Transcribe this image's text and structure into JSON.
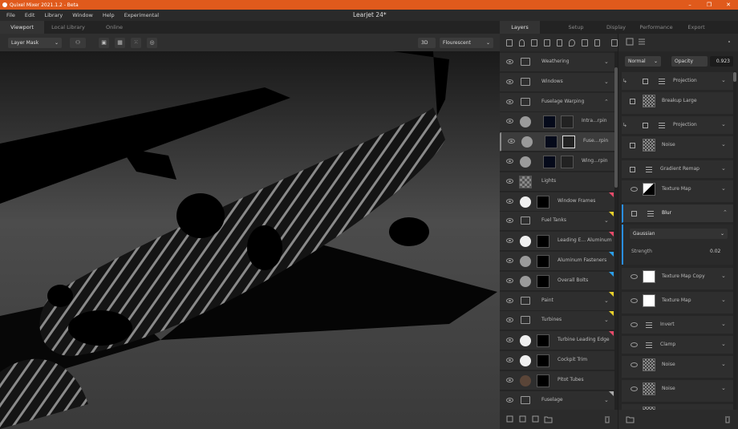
{
  "app": {
    "title": "Quixel Mixer 2021.1.2 - Beta",
    "doc_title": "Learjet 24*"
  },
  "menu": [
    "File",
    "Edit",
    "Library",
    "Window",
    "Help",
    "Experimental"
  ],
  "viewport_tabs": [
    "Viewport",
    "Local Library",
    "Online"
  ],
  "viewport_toolbar": {
    "mask_mode": "Layer Mask",
    "view_mode": "3D",
    "lighting": "Flourescent"
  },
  "right_tabs": [
    "Layers",
    "Setup",
    "Display",
    "Performance",
    "Export"
  ],
  "layers": [
    {
      "name": "Weathering",
      "kind": "folder",
      "chevron": "down",
      "flag": ""
    },
    {
      "name": "Windows",
      "kind": "folder",
      "chevron": "down",
      "flag": ""
    },
    {
      "name": "Fuselage Warping",
      "kind": "folder",
      "chevron": "up",
      "flag": ""
    },
    {
      "name": "Intra...rpin",
      "kind": "sub",
      "flag": ""
    },
    {
      "name": "Fuse...rpin",
      "kind": "sub",
      "flag": "",
      "selected": true
    },
    {
      "name": "Wing...rpin",
      "kind": "sub",
      "flag": ""
    },
    {
      "name": "Lights",
      "kind": "checker",
      "flag": ""
    },
    {
      "name": "Window Frames",
      "kind": "white",
      "flag": "#e84a6a"
    },
    {
      "name": "Fuel Tanks",
      "kind": "folder",
      "chevron": "down",
      "flag": "#e8d02a"
    },
    {
      "name": "Leading E... Aluminum",
      "kind": "white",
      "flag": "#e84a6a"
    },
    {
      "name": "Aluminum Fasteners",
      "kind": "grey",
      "flag": "#2a9ee8"
    },
    {
      "name": "Overall Bolts",
      "kind": "grey",
      "flag": "#2a9ee8"
    },
    {
      "name": "Paint",
      "kind": "folder",
      "chevron": "down",
      "flag": "#e8d02a"
    },
    {
      "name": "Turbines",
      "kind": "folder",
      "chevron": "down",
      "flag": "#e8d02a"
    },
    {
      "name": "Turbine Leading Edge",
      "kind": "white",
      "flag": "#e84a6a"
    },
    {
      "name": "Cockpit Trim",
      "kind": "white",
      "flag": ""
    },
    {
      "name": "Pitot Tubes",
      "kind": "brown",
      "flag": ""
    },
    {
      "name": "Fuselage",
      "kind": "folder",
      "chevron": "down",
      "flag": "#aaaaaa"
    }
  ],
  "blend": {
    "mode": "Normal",
    "opacity_label": "Opacity",
    "opacity_value": "0.923"
  },
  "components": [
    {
      "name": "Projection",
      "type": "slider",
      "chevron": "down",
      "indent": true
    },
    {
      "name": "Breakup Large",
      "type": "noise_chk",
      "chevron": ""
    },
    {
      "name": "Projection",
      "type": "slider",
      "chevron": "down",
      "indent": true
    },
    {
      "name": "Noise",
      "type": "noise_chk",
      "chevron": "down"
    },
    {
      "name": "Gradient Remap",
      "type": "slider_chk",
      "chevron": "down"
    },
    {
      "name": "Texture Map",
      "type": "bw_eye",
      "chevron": "down"
    },
    {
      "name": "Blur",
      "type": "slider_chk_exp",
      "chevron": "up"
    },
    {
      "name": "Texture Map Copy",
      "type": "white_eye",
      "chevron": "down"
    },
    {
      "name": "Texture Map",
      "type": "white_eye",
      "chevron": "down"
    },
    {
      "name": "Invert",
      "type": "slider_eye",
      "chevron": "down"
    },
    {
      "name": "Clamp",
      "type": "slider_eye",
      "chevron": "down"
    },
    {
      "name": "Noise",
      "type": "noise_eye",
      "chevron": "down"
    },
    {
      "name": "Noise",
      "type": "noise_eye",
      "chevron": "down"
    },
    {
      "name": "Noise",
      "type": "noise_eye",
      "chevron": "down"
    }
  ],
  "blur_params": {
    "type": "Gaussian",
    "strength_label": "Strength",
    "strength_value": "0.02"
  },
  "colors": {
    "accent": "#e05a1c",
    "selection_line": "#2a8ee8"
  }
}
